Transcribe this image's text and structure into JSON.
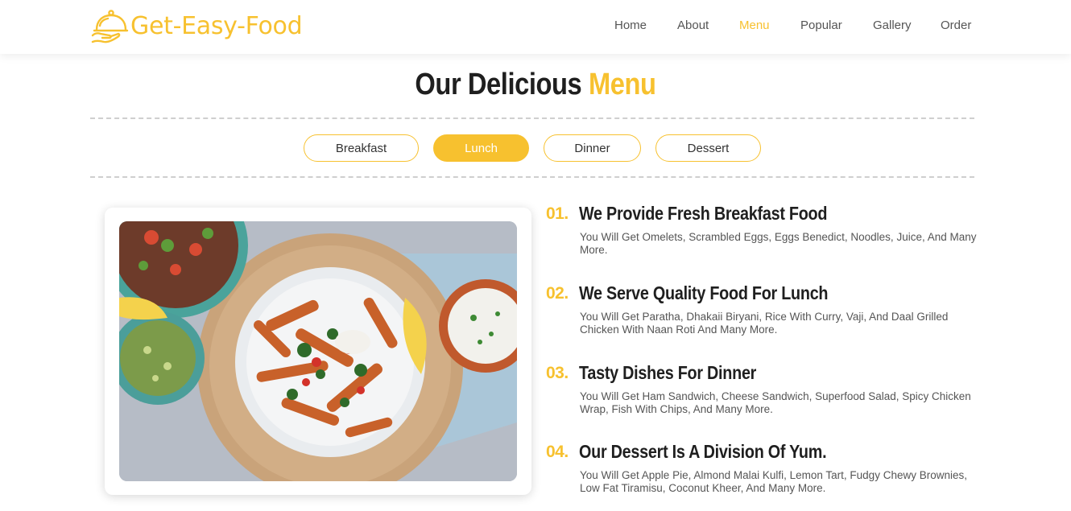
{
  "brand": {
    "name": "Get-Easy-Food",
    "icon": "food-cloche-icon",
    "color": "#f7c12f"
  },
  "nav": {
    "items": [
      {
        "label": "Home"
      },
      {
        "label": "About"
      },
      {
        "label": "Menu",
        "active": true
      },
      {
        "label": "Popular"
      },
      {
        "label": "Gallery"
      },
      {
        "label": "Order"
      }
    ]
  },
  "section": {
    "title_main": "Our Delicious",
    "title_accent": "Menu"
  },
  "tabs": [
    {
      "label": "Breakfast"
    },
    {
      "label": "Lunch",
      "active": true
    },
    {
      "label": "Dinner"
    },
    {
      "label": "Dessert"
    }
  ],
  "menu_items": [
    {
      "number": "01.",
      "title": "We Provide Fresh Breakfast Food",
      "description": "You Will Get Omelets, Scrambled Eggs, Eggs Benedict, Noodles, Juice, And Many More."
    },
    {
      "number": "02.",
      "title": "We Serve Quality Food For Lunch",
      "description": "You Will Get Paratha, Dhakaii Biryani, Rice With Curry, Vaji, And Daal Grilled Chicken With Naan Roti And Many More."
    },
    {
      "number": "03.",
      "title": "Tasty Dishes For Dinner",
      "description": "You Will Get Ham Sandwich, Cheese Sandwich, Superfood Salad, Spicy Chicken Wrap, Fish With Chips, And Many More."
    },
    {
      "number": "04.",
      "title": "Our Dessert Is A Division Of Yum.",
      "description": "You Will Get Apple Pie, Almond Malai Kulfi, Lemon Tart, Fudgy Chewy Brownies, Low Fat Tiramisu, Coconut Kheer, And Many More."
    }
  ],
  "colors": {
    "accent": "#f7c12f",
    "text_dark": "#1f1f1f",
    "text_muted": "#555555"
  }
}
